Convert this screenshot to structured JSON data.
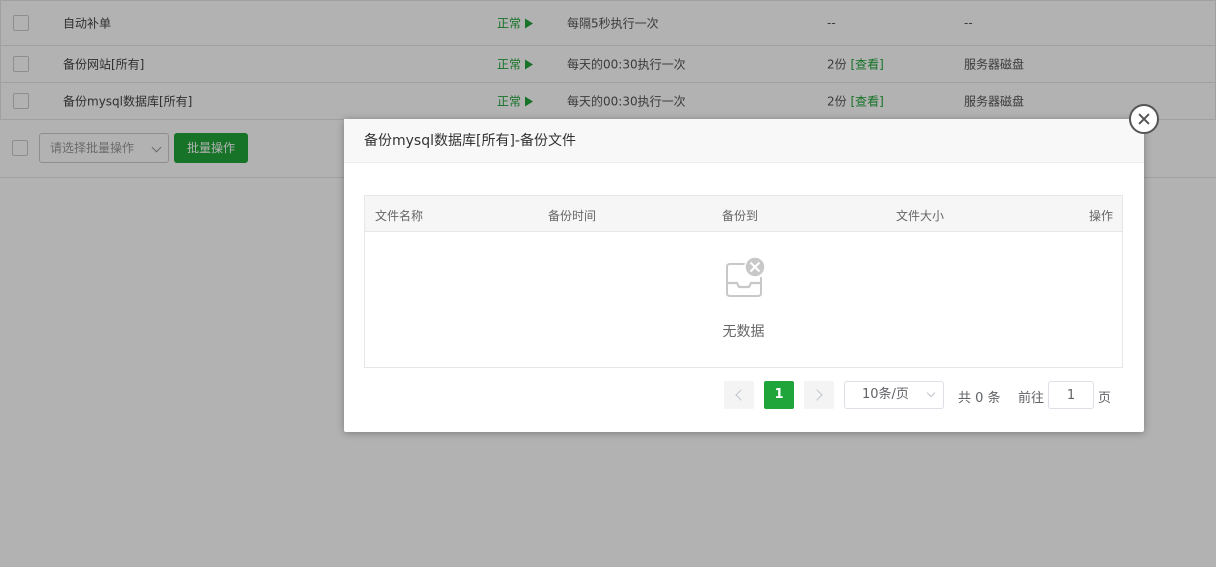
{
  "tasks": [
    {
      "name": "自动补单",
      "status": "正常",
      "cycle": "每隔5秒执行一次",
      "keep": "--",
      "keep_link": "",
      "target": "--"
    },
    {
      "name": "备份网站[所有]",
      "status": "正常",
      "cycle": "每天的00:30执行一次",
      "keep": "2份",
      "keep_link": "[查看]",
      "target": "服务器磁盘"
    },
    {
      "name": "备份mysql数据库[所有]",
      "status": "正常",
      "cycle": "每天的00:30执行一次",
      "keep": "2份",
      "keep_link": "[查看]",
      "target": "服务器磁盘"
    }
  ],
  "batch": {
    "select_placeholder": "请选择批量操作",
    "button_label": "批量操作"
  },
  "modal": {
    "title": "备份mysql数据库[所有]-备份文件",
    "columns": [
      "文件名称",
      "备份时间",
      "备份到",
      "文件大小",
      "操作"
    ],
    "empty_text": "无数据",
    "pagination": {
      "current_page": "1",
      "page_size": "10条/页",
      "total": "共 0 条",
      "goto_label": "前往",
      "goto_value": "1",
      "unit": "页"
    }
  },
  "colors": {
    "accent": "#20a53a",
    "overlay": "rgba(0,0,0,0.3)"
  },
  "icons": {
    "close": "close-circle-icon",
    "empty": "empty-inbox-icon",
    "play": "play-icon"
  }
}
